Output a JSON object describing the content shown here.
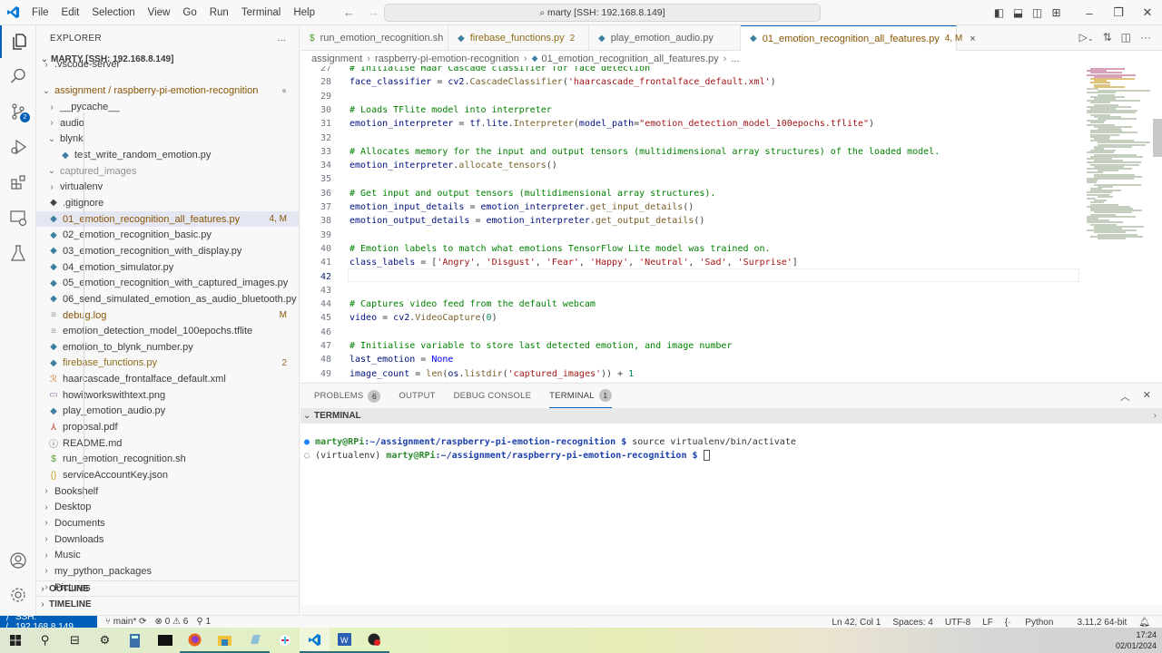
{
  "titlebar": {
    "menu": [
      "File",
      "Edit",
      "Selection",
      "View",
      "Go",
      "Run",
      "Terminal",
      "Help"
    ],
    "command_center": "marty [SSH: 192.168.8.149]",
    "window_controls": [
      "toggle-primary-sidebar",
      "toggle-panel",
      "toggle-secondary-sidebar",
      "customize-layout",
      "minimize",
      "restore",
      "close"
    ]
  },
  "activity_bar": {
    "items": [
      {
        "name": "explorer",
        "active": true
      },
      {
        "name": "search"
      },
      {
        "name": "source-control",
        "badge": "2"
      },
      {
        "name": "run-and-debug"
      },
      {
        "name": "extensions"
      },
      {
        "name": "remote-explorer"
      },
      {
        "name": "testing"
      }
    ],
    "bottom": [
      "accounts",
      "manage"
    ]
  },
  "sidebar": {
    "title": "EXPLORER",
    "more": "...",
    "root": "MARTY [SSH: 192.168.8.149]",
    "items": [
      {
        "label": ".vscode-server",
        "type": "folder",
        "expanded": false,
        "indent": 1,
        "partial": true
      },
      {
        "label": "assignment / raspberry-pi-emotion-recognition",
        "type": "folder",
        "expanded": true,
        "indent": 1,
        "decoration": "●",
        "color": "mod"
      },
      {
        "label": "__pycache__",
        "type": "folder",
        "expanded": false,
        "indent": 2
      },
      {
        "label": "audio",
        "type": "folder",
        "expanded": false,
        "indent": 2
      },
      {
        "label": "blynk",
        "type": "folder",
        "expanded": true,
        "indent": 2
      },
      {
        "label": "test_write_random_emotion.py",
        "type": "python",
        "indent": 3
      },
      {
        "label": "captured_images",
        "type": "folder",
        "expanded": true,
        "indent": 2,
        "color": "dim"
      },
      {
        "label": "virtualenv",
        "type": "folder",
        "expanded": false,
        "indent": 2
      },
      {
        "label": ".gitignore",
        "type": "git",
        "indent": 2
      },
      {
        "label": "01_emotion_recognition_all_features.py",
        "type": "python",
        "indent": 2,
        "decoration": "4, M",
        "color": "mod",
        "selected": true
      },
      {
        "label": "02_emotion_recognition_basic.py",
        "type": "python",
        "indent": 2
      },
      {
        "label": "03_emotion_recognition_with_display.py",
        "type": "python",
        "indent": 2
      },
      {
        "label": "04_emotion_simulator.py",
        "type": "python",
        "indent": 2
      },
      {
        "label": "05_emotion_recognition_with_captured_images.py",
        "type": "python",
        "indent": 2
      },
      {
        "label": "06_send_simulated_emotion_as_audio_bluetooth.py",
        "type": "python",
        "indent": 2
      },
      {
        "label": "debug.log",
        "type": "text",
        "indent": 2,
        "decoration": "M",
        "color": "mod"
      },
      {
        "label": "emotion_detection_model_100epochs.tflite",
        "type": "text",
        "indent": 2
      },
      {
        "label": "emotion_to_blynk_number.py",
        "type": "python",
        "indent": 2
      },
      {
        "label": "firebase_functions.py",
        "type": "python",
        "indent": 2,
        "decoration": "2",
        "color": "err"
      },
      {
        "label": "haarcascade_frontalface_default.xml",
        "type": "xml",
        "indent": 2
      },
      {
        "label": "howitworkswithtext.png",
        "type": "image",
        "indent": 2
      },
      {
        "label": "play_emotion_audio.py",
        "type": "python",
        "indent": 2
      },
      {
        "label": "proposal.pdf",
        "type": "pdf",
        "indent": 2
      },
      {
        "label": "README.md",
        "type": "info",
        "indent": 2
      },
      {
        "label": "run_emotion_recognition.sh",
        "type": "shell",
        "indent": 2
      },
      {
        "label": "serviceAccountKey.json",
        "type": "json",
        "indent": 2
      },
      {
        "label": "Bookshelf",
        "type": "folder",
        "expanded": false,
        "indent": 1
      },
      {
        "label": "Desktop",
        "type": "folder",
        "expanded": false,
        "indent": 1
      },
      {
        "label": "Documents",
        "type": "folder",
        "expanded": false,
        "indent": 1
      },
      {
        "label": "Downloads",
        "type": "folder",
        "expanded": false,
        "indent": 1
      },
      {
        "label": "Music",
        "type": "folder",
        "expanded": false,
        "indent": 1
      },
      {
        "label": "my_python_packages",
        "type": "folder",
        "expanded": false,
        "indent": 1
      },
      {
        "label": "Pictures",
        "type": "folder",
        "expanded": false,
        "indent": 1
      }
    ],
    "outline": "OUTLINE",
    "timeline": "TIMELINE"
  },
  "tabs": [
    {
      "label": "run_emotion_recognition.sh",
      "icon": "$",
      "iconColor": "#4d9a2a"
    },
    {
      "label": "firebase_functions.py",
      "icon": "py",
      "decoration": "2",
      "color": "err"
    },
    {
      "label": "play_emotion_audio.py",
      "icon": "py"
    },
    {
      "label": "01_emotion_recognition_all_features.py",
      "icon": "py",
      "decoration": "4, M",
      "color": "mod",
      "active": true,
      "close": "×"
    }
  ],
  "breadcrumb": [
    "assignment",
    "raspberry-pi-emotion-recognition",
    "01_emotion_recognition_all_features.py",
    "..."
  ],
  "editor": {
    "current_line": 42,
    "lines": [
      {
        "n": 27,
        "html": "<span class='c'># Initialise Haar Cascade classifier for face detection</span>"
      },
      {
        "n": 28,
        "html": "<span class='v'>face_classifier</span> = <span class='v'>cv2</span>.<span class='f'>CascadeClassifier</span>(<span class='s'>'haarcascade_frontalface_default.xml'</span>)"
      },
      {
        "n": 29,
        "html": ""
      },
      {
        "n": 30,
        "html": "<span class='c'># Loads TFlite model into interpreter</span>"
      },
      {
        "n": 31,
        "html": "<span class='v'>emotion_interpreter</span> = <span class='v'>tf</span>.<span class='v'>lite</span>.<span class='f'>Interpreter</span>(<span class='v'>model_path</span>=<span class='s'>\"emotion_detection_model_100epochs.tflite\"</span>)"
      },
      {
        "n": 32,
        "html": ""
      },
      {
        "n": 33,
        "html": "<span class='c'># Allocates memory for the input and output tensors (multidimensional array structures) of the loaded model.</span>"
      },
      {
        "n": 34,
        "html": "<span class='v'>emotion_interpreter</span>.<span class='f'>allocate_tensors</span>()"
      },
      {
        "n": 35,
        "html": ""
      },
      {
        "n": 36,
        "html": "<span class='c'># Get input and output tensors (multidimensional array structures).</span>"
      },
      {
        "n": 37,
        "html": "<span class='v'>emotion_input_details</span> = <span class='v'>emotion_interpreter</span>.<span class='f'>get_input_details</span>()"
      },
      {
        "n": 38,
        "html": "<span class='v'>emotion_output_details</span> = <span class='v'>emotion_interpreter</span>.<span class='f'>get_output_details</span>()"
      },
      {
        "n": 39,
        "html": ""
      },
      {
        "n": 40,
        "html": "<span class='c'># Emotion labels to match what emotions TensorFlow Lite model was trained on.</span>"
      },
      {
        "n": 41,
        "html": "<span class='v'>class_labels</span> = [<span class='s'>'Angry'</span>, <span class='s'>'Disgust'</span>, <span class='s'>'Fear'</span>, <span class='s'>'Happy'</span>, <span class='s'>'Neutral'</span>, <span class='s'>'Sad'</span>, <span class='s'>'Surprise'</span>]"
      },
      {
        "n": 42,
        "html": ""
      },
      {
        "n": 43,
        "html": ""
      },
      {
        "n": 44,
        "html": "<span class='c'># Captures video feed from the default webcam</span>"
      },
      {
        "n": 45,
        "html": "<span class='v'>video</span> = <span class='v'>cv2</span>.<span class='f'>VideoCapture</span>(<span class='n'>0</span>)"
      },
      {
        "n": 46,
        "html": ""
      },
      {
        "n": 47,
        "html": "<span class='c'># Initialise variable to store last detected emotion, and image number</span>"
      },
      {
        "n": 48,
        "html": "<span class='v'>last_emotion</span> = <span class='k'>None</span>"
      },
      {
        "n": 49,
        "html": "<span class='v'>image_count</span> = <span class='f'>len</span>(<span class='v'>os</span>.<span class='f'>listdir</span>(<span class='s'>'captured_images'</span>)) + <span class='n'>1</span>"
      }
    ]
  },
  "panel": {
    "tabs": [
      {
        "label": "PROBLEMS",
        "badge": "6"
      },
      {
        "label": "OUTPUT"
      },
      {
        "label": "DEBUG CONSOLE"
      },
      {
        "label": "TERMINAL",
        "badge": "1",
        "active": true
      }
    ],
    "section": "TERMINAL",
    "terminal": {
      "line1_user": "marty@RPi",
      "line1_path": ":~/assignment/raspberry-pi-emotion-recognition $",
      "line1_cmd": " source virtualenv/bin/activate",
      "line2_env": "(virtualenv) ",
      "line2_user": "marty@RPi",
      "line2_path": ":~/assignment/raspberry-pi-emotion-recognition $"
    }
  },
  "statusbar": {
    "remote": "SSH: 192.168.8.149",
    "branch": "main*",
    "errors": "0",
    "warnings": "6",
    "ports": "1",
    "position": "Ln 42, Col 1",
    "spaces": "Spaces: 4",
    "encoding": "UTF-8",
    "eol": "LF",
    "language": "Python",
    "interpreter": "3.11.2 64-bit"
  },
  "taskbar": {
    "apps": [
      "start",
      "search",
      "task-view",
      "settings",
      "calculator",
      "terminal",
      "firefox",
      "file-explorer",
      "notes",
      "slack",
      "vscode",
      "word",
      "obs"
    ],
    "time": "17:24",
    "date": "02/01/2024"
  }
}
